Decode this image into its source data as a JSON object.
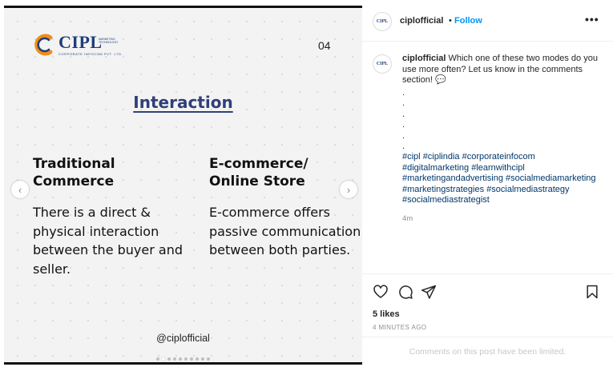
{
  "slide": {
    "logo": {
      "word": "CIPL",
      "tagline": "MARKETING TECHNOLOGY",
      "subtitle": "CORPORATE INFOCOM PVT. LTD."
    },
    "page_number": "04",
    "heading": "Interaction",
    "left_column": {
      "title": "Traditional Commerce",
      "body": "There is a direct & physical interaction between the buyer and seller."
    },
    "right_column": {
      "title": "E-commerce/ Online Store",
      "body": "E-commerce offers passive communication between both parties."
    },
    "handle": "@ciplofficial",
    "prev_icon": "chevron-left",
    "next_icon": "chevron-right",
    "dot_count": 10,
    "active_dot": 1
  },
  "post": {
    "header": {
      "avatar_label": "CIPL",
      "username": "ciplofficial",
      "separator": "•",
      "follow_label": "Follow",
      "more_label": "•••"
    },
    "caption": {
      "username": "ciplofficial",
      "text": "Which one of these two modes do you use more often? Let us know in the comments section!",
      "emoji": "💬",
      "dots": [
        ".",
        ".",
        ".",
        ".",
        ".",
        "."
      ],
      "hashtags": [
        "#cipl",
        "#ciplindia",
        "#corporateinfocom",
        "#digitalmarketing",
        "#learnwithcipl",
        "#marketingandadvertising",
        "#socialmediamarketing",
        "#marketingstrategies",
        "#socialmediastrategy",
        "#socialmediastrategist"
      ],
      "time_ago": "4m"
    },
    "actions": {
      "like_icon": "heart-outline",
      "comment_icon": "speech-bubble",
      "share_icon": "paper-plane",
      "save_icon": "bookmark-outline"
    },
    "likes": "5 likes",
    "posted": "4 MINUTES AGO",
    "comments_notice": "Comments on this post have been limited.",
    "colors": {
      "follow": "#0095f6",
      "hashtag": "#00376b",
      "brand": "#1f3e7a",
      "heading": "#2f3f7a"
    }
  }
}
